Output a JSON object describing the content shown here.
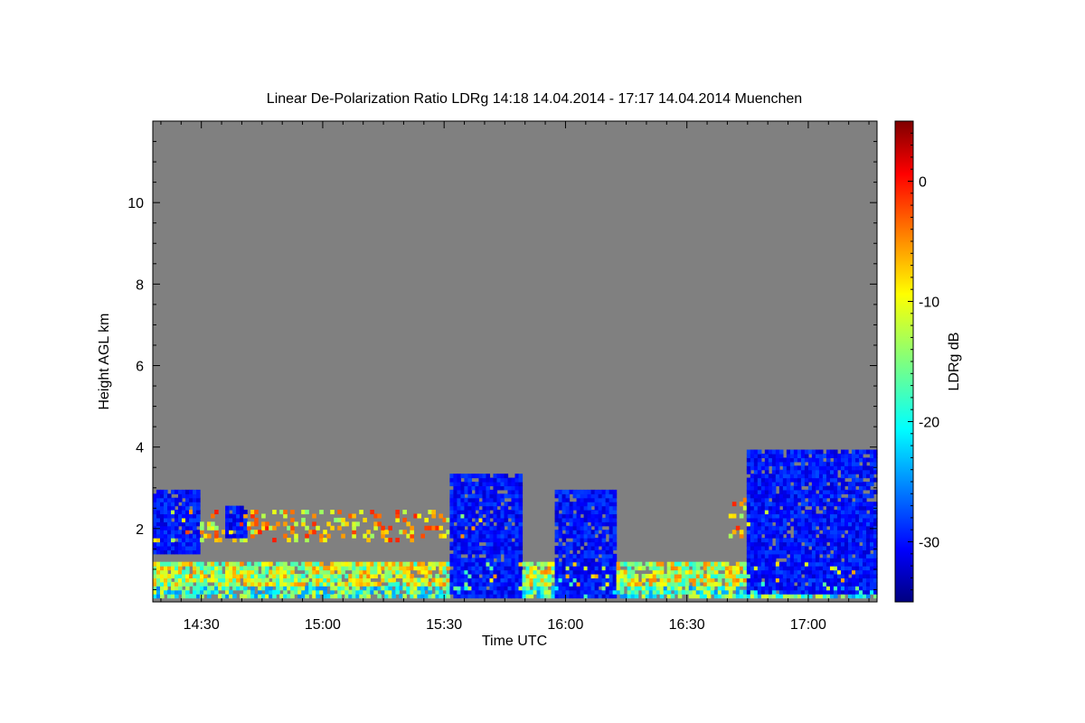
{
  "chart_data": {
    "type": "heatmap",
    "title": "Linear De-Polarization Ratio LDRg   14:18 14.04.2014 - 17:17 14.04.2014 Muenchen",
    "xlabel": "Time UTC",
    "ylabel": "Height AGL km",
    "colorbar_label": "LDRg dB",
    "x_range_minutes_utc": [
      858,
      1037
    ],
    "x_ticks": [
      {
        "minute": 870,
        "label": "14:30"
      },
      {
        "minute": 900,
        "label": "15:00"
      },
      {
        "minute": 930,
        "label": "15:30"
      },
      {
        "minute": 960,
        "label": "16:00"
      },
      {
        "minute": 990,
        "label": "16:30"
      },
      {
        "minute": 1020,
        "label": "17:00"
      }
    ],
    "y_range_km": [
      0.2,
      12.0
    ],
    "y_ticks": [
      {
        "value": 2,
        "label": "2"
      },
      {
        "value": 4,
        "label": "4"
      },
      {
        "value": 6,
        "label": "6"
      },
      {
        "value": 8,
        "label": "8"
      },
      {
        "value": 10,
        "label": "10"
      }
    ],
    "colorbar_range_db": [
      -35,
      5
    ],
    "colorbar_ticks": [
      {
        "value": 0,
        "label": "0"
      },
      {
        "value": -10,
        "label": "-10"
      },
      {
        "value": -20,
        "label": "-20"
      },
      {
        "value": -30,
        "label": "-30"
      }
    ],
    "colormap": "jet",
    "no_signal_color": "#808080",
    "features": [
      {
        "name": "near-surface aerosol layer",
        "t": [
          858,
          1037
        ],
        "h": [
          0.25,
          1.2
        ],
        "ldr_db": -12
      },
      {
        "name": "elevated residual layer",
        "t": [
          858,
          940
        ],
        "h": [
          1.7,
          2.5
        ],
        "ldr_db": -8
      },
      {
        "name": "low cloud 14:20",
        "t": [
          858,
          870
        ],
        "h": [
          1.4,
          3.0
        ],
        "ldr_db": -30
      },
      {
        "name": "low cloud 14:40",
        "t": [
          876,
          881
        ],
        "h": [
          1.8,
          2.6
        ],
        "ldr_db": -30
      },
      {
        "name": "cloud 15:30-15:50",
        "t": [
          931,
          949
        ],
        "h": [
          0.25,
          3.3
        ],
        "ldr_db": -30
      },
      {
        "name": "cloud 16:00",
        "t": [
          957,
          973
        ],
        "h": [
          0.3,
          3.0
        ],
        "ldr_db": -30
      },
      {
        "name": "ice/aerosol plume 16:45",
        "t": [
          1000,
          1010
        ],
        "h": [
          1.8,
          2.9
        ],
        "ldr_db": -8
      },
      {
        "name": "mid-level cloud 16:50-17:15",
        "t": [
          1005,
          1037
        ],
        "h": [
          0.4,
          3.9
        ],
        "ldr_db": -30
      }
    ]
  }
}
